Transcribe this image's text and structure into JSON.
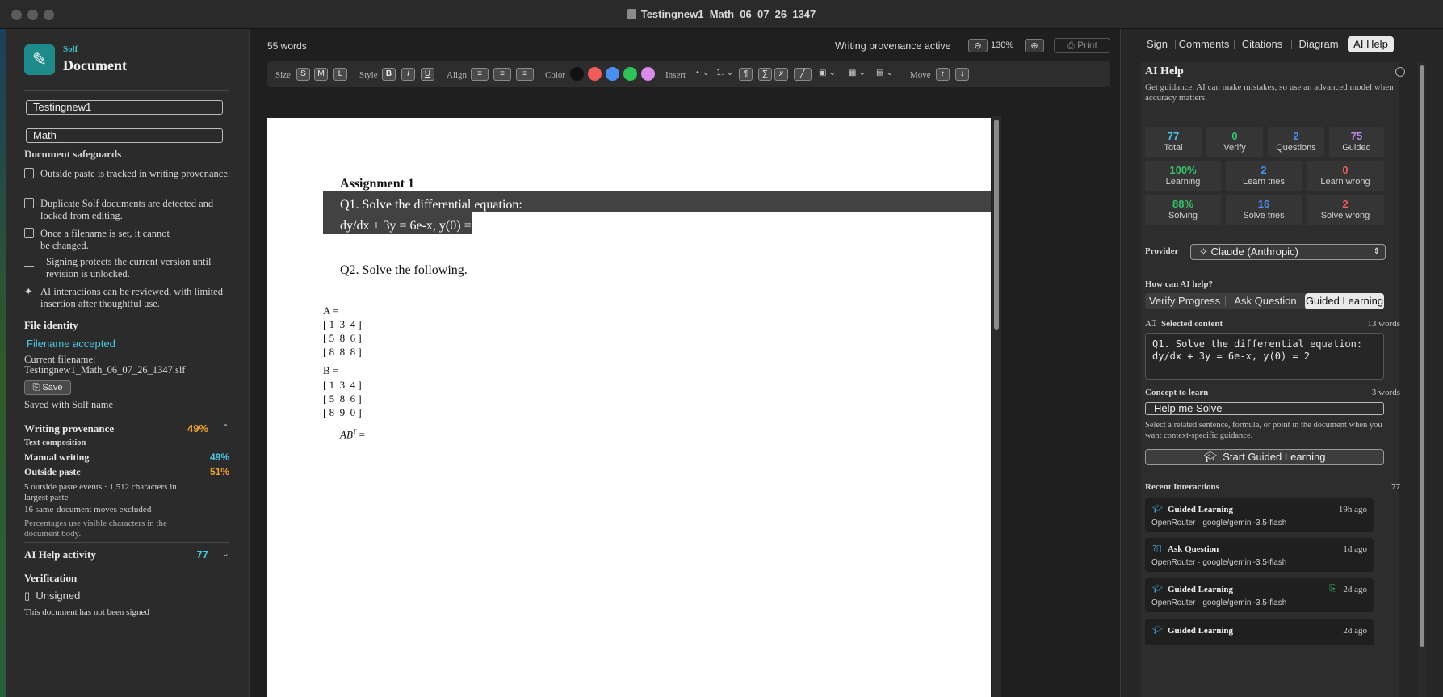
{
  "window": {
    "title": "Testingnew1_Math_06_07_26_1347"
  },
  "sidebar": {
    "brand_small": "Solf",
    "brand_title": "Document",
    "name_field": "Testingnew1",
    "subject_field": "Math",
    "safeguards_heading": "Document safeguards",
    "safeguards": [
      "Outside paste is tracked in writing provenance.",
      "Duplicate Solf documents are detected and locked from editing.",
      "Once a filename is set, it cannot be changed.",
      "Signing protects the current version until revision is unlocked.",
      "AI interactions can be reviewed, with limited insertion after thoughtful use."
    ],
    "file_identity_heading": "File identity",
    "filename_status": "Filename accepted",
    "current_filename_label": "Current filename:",
    "current_filename": "Testingnew1_Math_06_07_26_1347.slf",
    "save_label": "Save",
    "saved_note": "Saved with Solf name",
    "provenance_heading": "Writing provenance",
    "provenance_percent": "49%",
    "text_composition_label": "Text composition",
    "manual_label": "Manual writing",
    "manual_value": "49%",
    "paste_label": "Outside paste",
    "paste_value": "51%",
    "paste_events_note": "5 outside paste events · 1,512 characters in largest paste",
    "moves_note": "16 same-document moves excluded",
    "percent_note": "Percentages use visible characters in the document body.",
    "ai_activity_heading": "AI Help activity",
    "ai_activity_count": "77",
    "verification_heading": "Verification",
    "verification_status": "Unsigned",
    "verification_note": "This document has not been signed"
  },
  "main": {
    "word_count": "55 words",
    "provenance_active": "Writing provenance active",
    "zoom_level": "130%",
    "print_label": "Print",
    "toolbar": {
      "size_label": "Size",
      "sizes": [
        "S",
        "M",
        "L"
      ],
      "style_label": "Style",
      "styles": [
        "B",
        "I",
        "U"
      ],
      "align_label": "Align",
      "color_label": "Color",
      "colors": [
        "#111111",
        "#ef5c5c",
        "#4a8ef0",
        "#30c25a",
        "#d88be8"
      ],
      "insert_label": "Insert",
      "list_label": "1.",
      "move_label": "Move"
    },
    "document": {
      "heading": "Assignment 1",
      "q1_line1": "Q1. Solve the differential equation:",
      "q1_line2": "dy/dx + 3y = 6e-x, y(0) = 2",
      "q2": "Q2. Solve the following.",
      "matrix_a_label": "A =",
      "matrix_a_rows": [
        "[ 1  3  4 ]",
        "[ 5  8  6 ]",
        "[ 8  8  8 ]"
      ],
      "matrix_b_label": "B =",
      "matrix_b_rows": [
        "[ 1  3  4 ]",
        "[ 5  8  6 ]",
        "[ 8  9  0 ]"
      ],
      "expr_base": "AB",
      "expr_sup": "T",
      "expr_tail": " ="
    }
  },
  "right_panel": {
    "tabs": [
      "Sign",
      "Comments",
      "Citations",
      "Diagram",
      "AI Help"
    ],
    "active_tab": "AI Help",
    "title": "AI Help",
    "description": "Get guidance. AI can make mistakes, so use an advanced model when accuracy matters.",
    "stats_row1": [
      {
        "value": "77",
        "label": "Total",
        "color": "#4cc3e8"
      },
      {
        "value": "0",
        "label": "Verify",
        "color": "#38c26a"
      },
      {
        "value": "2",
        "label": "Questions",
        "color": "#4a8ef0"
      },
      {
        "value": "75",
        "label": "Guided",
        "color": "#c08ae8"
      }
    ],
    "stats_row2": [
      {
        "value": "100%",
        "label": "Learning",
        "color": "#38c26a"
      },
      {
        "value": "2",
        "label": "Learn tries",
        "color": "#4a8ef0"
      },
      {
        "value": "0",
        "label": "Learn wrong",
        "color": "#ef5c5c"
      }
    ],
    "stats_row3": [
      {
        "value": "88%",
        "label": "Solving",
        "color": "#38c26a"
      },
      {
        "value": "16",
        "label": "Solve tries",
        "color": "#4a8ef0"
      },
      {
        "value": "2",
        "label": "Solve wrong",
        "color": "#ef5c5c"
      }
    ],
    "provider_label": "Provider",
    "provider_value": "Claude (Anthropic)",
    "how_label": "How can AI help?",
    "modes": [
      "Verify Progress",
      "Ask Question",
      "Guided Learning"
    ],
    "active_mode": "Guided Learning",
    "selected_label": "Selected content",
    "selected_count": "13 words",
    "selected_line1": "Q1. Solve the differential equation:",
    "selected_line2": "dy/dx + 3y = 6e-x, y(0) = 2",
    "concept_label": "Concept to learn",
    "concept_count": "3 words",
    "concept_value": "Help me Solve",
    "concept_hint": "Select a related sentence, formula, or point in the document when you want context-specific guidance.",
    "start_label": "Start Guided Learning",
    "recent_label": "Recent Interactions",
    "recent_count": "77",
    "interactions": [
      {
        "type": "Guided Learning",
        "age": "19h ago",
        "model": "OpenRouter · google/gemini-3.5-flash"
      },
      {
        "type": "Ask Question",
        "age": "1d ago",
        "model": "OpenRouter · google/gemini-3.5-flash"
      },
      {
        "type": "Guided Learning",
        "age": "2d ago",
        "model": "OpenRouter · google/gemini-3.5-flash"
      },
      {
        "type": "Guided Learning",
        "age": "2d ago",
        "model": ""
      }
    ]
  }
}
